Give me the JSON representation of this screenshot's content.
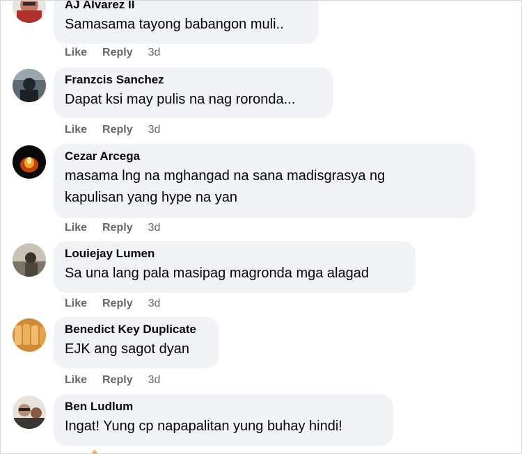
{
  "actions": {
    "like": "Like",
    "reply": "Reply"
  },
  "comments": [
    {
      "author": "AJ Alvarez II",
      "text": "Samasama tayong babangon muli..",
      "time": "3d"
    },
    {
      "author": "Franzcis Sanchez",
      "text": "Dapat ksi may pulis na nag roronda...",
      "time": "3d"
    },
    {
      "author": "Cezar Arcega",
      "text_lines": [
        "masama lng na mghangad na sana madisgrasya ng",
        "kapulisan yang hype na yan"
      ],
      "time": "3d"
    },
    {
      "author": "Louiejay Lumen",
      "text": "Sa una lang pala masipag magronda mga alagad",
      "time": "3d"
    },
    {
      "author": "Benedict Key Duplicate",
      "text": "EJK ang sagot dyan",
      "time": "3d"
    },
    {
      "author": "Ben Ludlum",
      "text": "Ingat! Yung cp napapalitan yung buhay hindi!",
      "time": ""
    }
  ],
  "colors": {
    "bubble": "#f0f2f5",
    "meta": "#65676b",
    "text": "#050505"
  }
}
